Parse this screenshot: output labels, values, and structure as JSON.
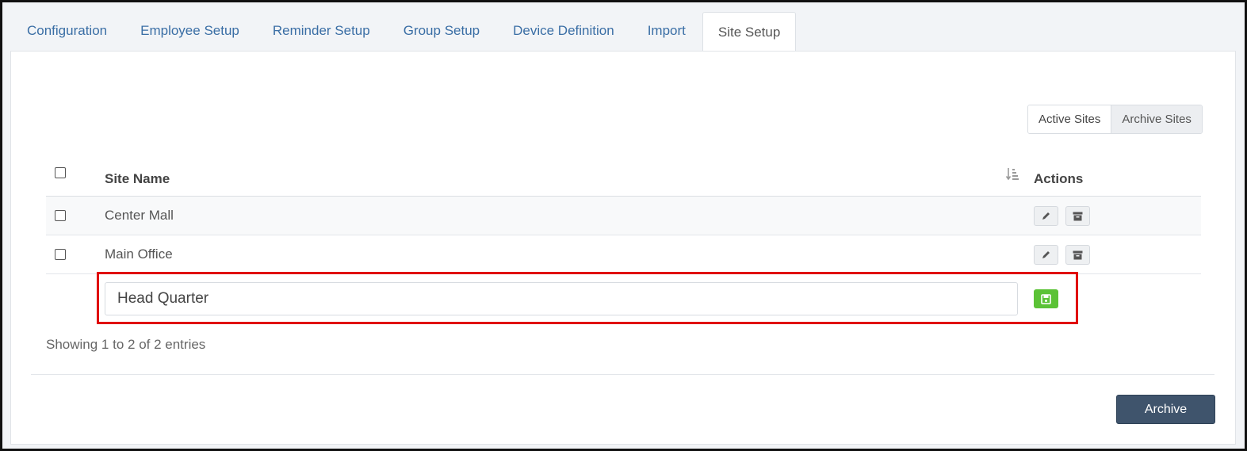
{
  "tabs": [
    {
      "label": "Configuration"
    },
    {
      "label": "Employee Setup"
    },
    {
      "label": "Reminder Setup"
    },
    {
      "label": "Group Setup"
    },
    {
      "label": "Device Definition"
    },
    {
      "label": "Import"
    },
    {
      "label": "Site Setup",
      "active": true
    }
  ],
  "view_toggle": {
    "active_label": "Active Sites",
    "archive_label": "Archive Sites"
  },
  "table": {
    "headers": {
      "site_name": "Site Name",
      "actions": "Actions"
    },
    "rows": [
      {
        "site_name": "Center Mall"
      },
      {
        "site_name": "Main Office"
      }
    ],
    "new_row": {
      "value": "Head Quarter"
    }
  },
  "footer": {
    "showing": "Showing 1 to 2 of 2 entries",
    "archive_label": "Archive"
  },
  "colors": {
    "accent": "#3a6ea5",
    "save": "#5bc236",
    "archive_button": "#3f546c",
    "highlight": "#e00000"
  },
  "icons": {
    "sort": "sort-icon",
    "edit": "pencil-icon",
    "archive": "archive-box-icon",
    "save": "floppy-disk-icon"
  }
}
